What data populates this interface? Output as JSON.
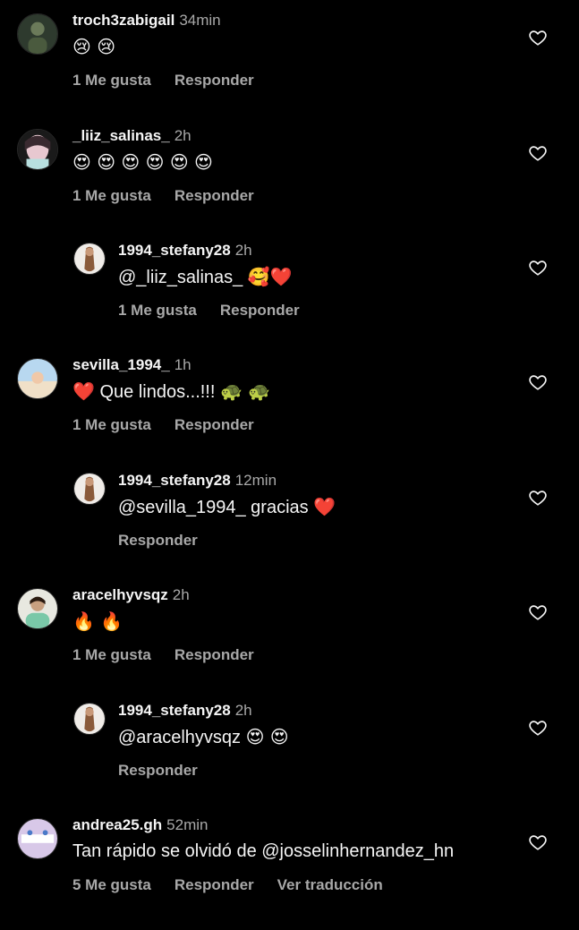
{
  "comments": [
    {
      "username": "troch3zabigail",
      "time": "34min",
      "text": "😢 😢",
      "likes": "1 Me gusta",
      "reply": "Responder",
      "avatar_color": "#3a4a3a"
    },
    {
      "username": "_liiz_salinas_",
      "time": "2h",
      "text": "😍 😍 😍 😍 😍 😍",
      "likes": "1 Me gusta",
      "reply": "Responder",
      "avatar_color": "#d8a8b8"
    },
    {
      "username": "1994_stefany28",
      "time": "2h",
      "text_prefix": "@_liiz_salinas_ ",
      "text_emoji": "🥰❤️",
      "likes": "1 Me gusta",
      "reply": "Responder",
      "avatar_color": "#e8e0d8"
    },
    {
      "username": "sevilla_1994_",
      "time": "1h",
      "text_heart": "❤️",
      "text_main": " Que lindos...!!! ",
      "text_emoji": "🐢 🐢",
      "likes": "1 Me gusta",
      "reply": "Responder",
      "avatar_color": "#a8c8e0"
    },
    {
      "username": "1994_stefany28",
      "time": "12min",
      "text_prefix": "@sevilla_1994_ gracias ",
      "text_emoji": "❤️",
      "reply": "Responder",
      "avatar_color": "#e8e0d8"
    },
    {
      "username": "aracelhyvsqz",
      "time": "2h",
      "text": "🔥 🔥",
      "likes": "1 Me gusta",
      "reply": "Responder",
      "avatar_color": "#5a8a70"
    },
    {
      "username": "1994_stefany28",
      "time": "2h",
      "text_prefix": "@aracelhyvsqz ",
      "text_emoji": "😍 😍",
      "reply": "Responder",
      "avatar_color": "#e8e0d8"
    },
    {
      "username": "andrea25.gh",
      "time": "52min",
      "text": "Tan rápido se olvidó de @josselinhernandez_hn",
      "likes": "5 Me gusta",
      "reply": "Responder",
      "translate": "Ver traducción",
      "avatar_color": "#c8b8d8"
    }
  ],
  "icons": {
    "like": "heart-outline-icon"
  },
  "colors": {
    "background": "#000000",
    "primary_text": "#f5f5f5",
    "secondary_text": "#a8a8a8",
    "heart_red": "#ff3040"
  }
}
